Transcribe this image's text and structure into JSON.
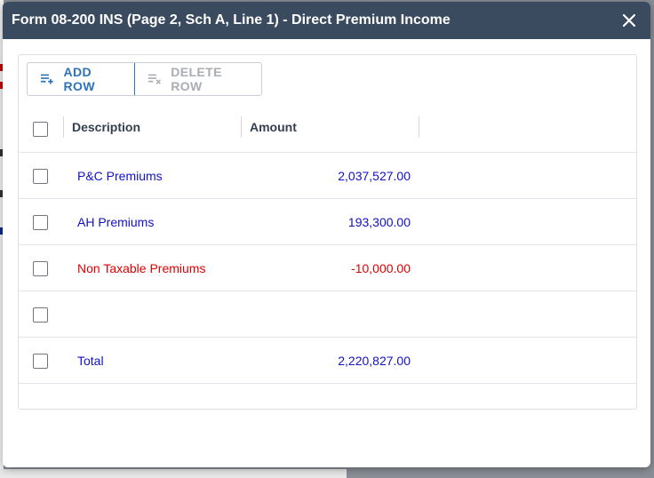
{
  "dialog": {
    "title": "Form 08-200 INS (Page 2, Sch A, Line 1) - Direct Premium Income",
    "close_icon": "close-icon"
  },
  "toolbar": {
    "add_row_label": "ADD ROW",
    "add_row_icon": "add-row-icon",
    "delete_row_label": "DELETE ROW",
    "delete_row_icon": "delete-row-icon"
  },
  "grid": {
    "columns": [
      "Description",
      "Amount"
    ],
    "rows": [
      {
        "description": "P&C Premiums",
        "amount": "2,037,527.00",
        "color": "#1010c8"
      },
      {
        "description": "AH Premiums",
        "amount": "193,300.00",
        "color": "#1010c8"
      },
      {
        "description": "Non Taxable Premiums",
        "amount": "-10,000.00",
        "color": "#e00000"
      },
      {
        "description": "",
        "amount": "",
        "color": "#1010c8"
      },
      {
        "description": "Total",
        "amount": "2,220,827.00",
        "color": "#1010c8"
      }
    ]
  },
  "colors": {
    "titlebar": "#3a4a5f",
    "accent": "#2e73b8",
    "positive_text": "#1010c8",
    "negative_text": "#e00000"
  }
}
